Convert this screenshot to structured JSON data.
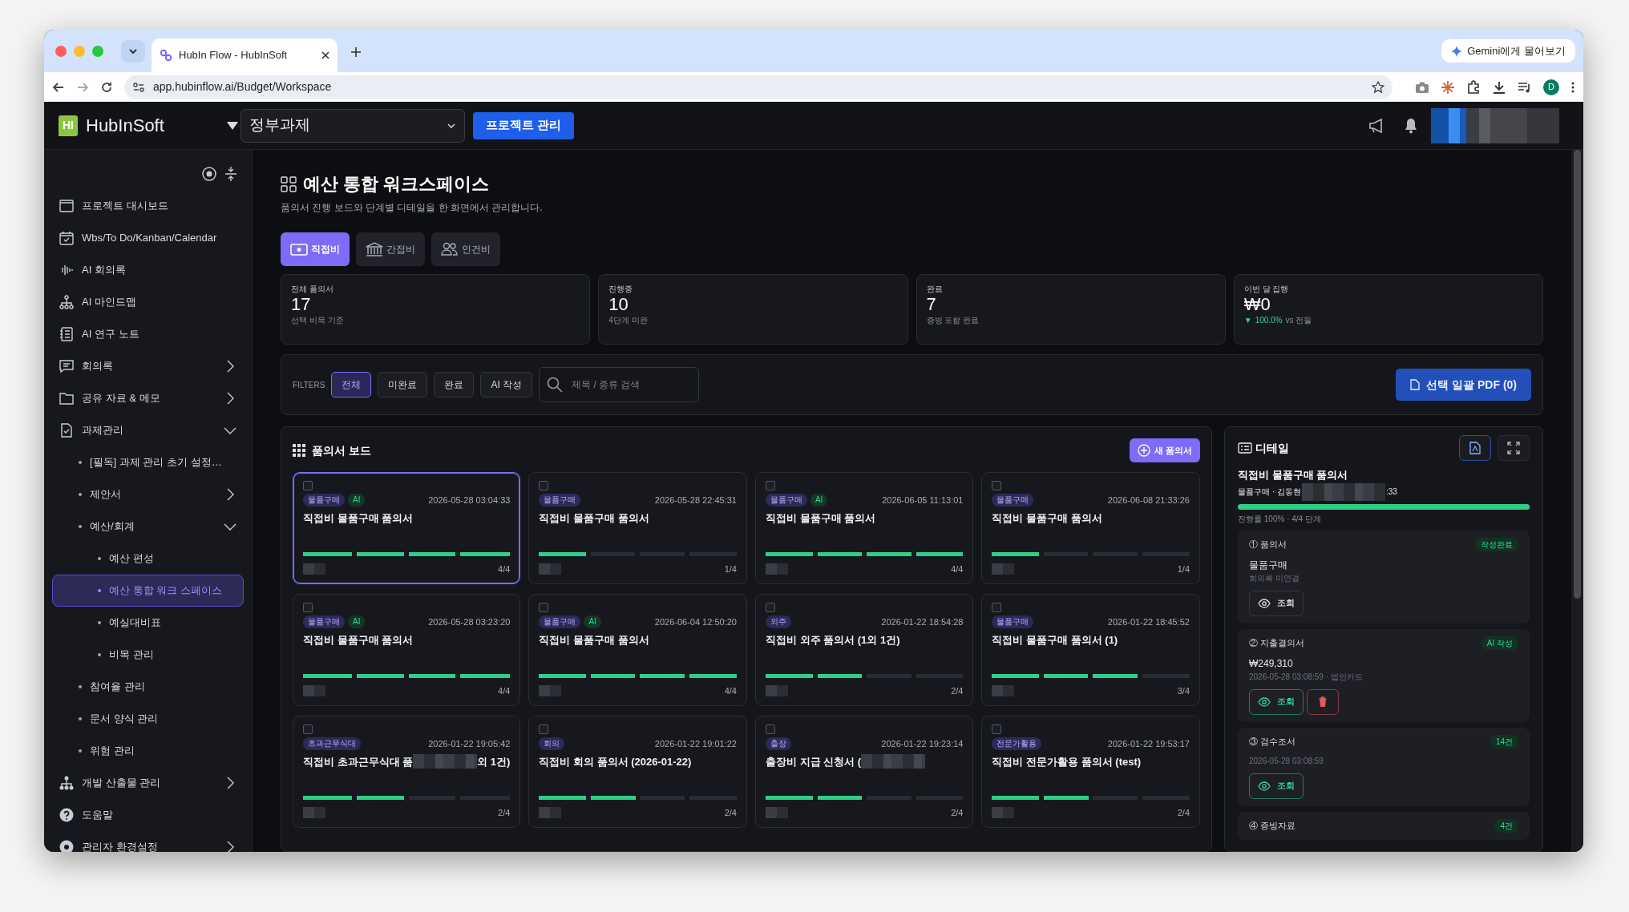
{
  "browser": {
    "tab_title": "HubIn Flow - HubInSoft",
    "url": "app.hubinflow.ai/Budget/Workspace",
    "gemini_button": "Gemini에게 물어보기",
    "profile_initial": "D"
  },
  "header": {
    "logo_mark": "HI",
    "brand": "HubInSoft",
    "project_select": "정부과제",
    "project_button": "프로젝트 관리"
  },
  "sidebar": {
    "items": [
      {
        "label": "프로젝트 대시보드",
        "selected": false
      },
      {
        "label": "Wbs/To Do/Kanban/Calendar",
        "selected": false
      },
      {
        "label": "AI 회의록",
        "selected": false
      },
      {
        "label": "AI 마인드맵",
        "selected": false
      },
      {
        "label": "AI 연구 노트",
        "selected": false
      },
      {
        "label": "회의록",
        "selected": false,
        "expanded": false
      },
      {
        "label": "공유 자료 & 메모",
        "selected": false,
        "expanded": false
      },
      {
        "label": "과제관리",
        "selected": false,
        "expanded": true,
        "children": [
          {
            "label": "[필독] 과제 관리 초기 설정…",
            "selected": false
          },
          {
            "label": "제안서",
            "selected": false,
            "expanded": false
          },
          {
            "label": "예산/회계",
            "selected": false,
            "expanded": true,
            "children": [
              {
                "label": "예산 편성",
                "selected": false
              },
              {
                "label": "예산 통합 워크 스페이스",
                "selected": true
              },
              {
                "label": "예실대비표",
                "selected": false
              },
              {
                "label": "비목 관리",
                "selected": false
              }
            ]
          },
          {
            "label": "참여율 관리",
            "selected": false
          },
          {
            "label": "문서 양식 관리",
            "selected": false
          },
          {
            "label": "위험 관리",
            "selected": false
          }
        ]
      },
      {
        "label": "개발 산출물 관리",
        "selected": false,
        "expanded": false
      },
      {
        "label": "도움말",
        "selected": false
      },
      {
        "label": "관리자 환경설정",
        "selected": false,
        "expanded": false
      }
    ]
  },
  "page": {
    "title": "예산 통합 워크스페이스",
    "subtitle": "품의서 진행 보드와 단계별 디테일을 한 화면에서 관리합니다."
  },
  "tabs": [
    {
      "label": "직접비",
      "selected": true
    },
    {
      "label": "간접비",
      "selected": false
    },
    {
      "label": "인건비",
      "selected": false
    }
  ],
  "stats": [
    {
      "label": "전체 품의서",
      "value": "17",
      "note": "선택 비목 기준"
    },
    {
      "label": "진행중",
      "value": "10",
      "note": "4단계 미완"
    },
    {
      "label": "완료",
      "value": "7",
      "note": "증빙 포함 완료"
    },
    {
      "label": "이번 달 집행",
      "value": "₩0",
      "trend": {
        "arrow": "▼",
        "value": "100.0%",
        "text": "vs 전월"
      }
    }
  ],
  "filters": {
    "label": "FILTERS",
    "chips": [
      {
        "label": "전체",
        "selected": true
      },
      {
        "label": "미완료",
        "selected": false
      },
      {
        "label": "완료",
        "selected": false
      },
      {
        "label": "AI 작성",
        "selected": false
      }
    ],
    "search_placeholder": "제목 / 종류 검색",
    "pdf_button": "선택 일괄 PDF (0)"
  },
  "board": {
    "title": "품의서 보드",
    "new_button": "새 품의서",
    "cards": [
      {
        "selected": true,
        "checked": false,
        "tags": [
          {
            "label": "물품구매",
            "kind": "category"
          },
          {
            "label": "AI",
            "kind": "ai"
          }
        ],
        "date": "2026-05-28 03:04:33",
        "title": "직접비 물품구매 품의서",
        "level": 1,
        "steps": "4/4"
      },
      {
        "selected": false,
        "checked": false,
        "tags": [
          {
            "label": "물품구매",
            "kind": "category"
          }
        ],
        "date": "2026-05-28 22:45:31",
        "title": "직접비 물품구매 품의서",
        "level": 0.25,
        "steps": "1/4"
      },
      {
        "selected": false,
        "checked": false,
        "tags": [
          {
            "label": "물품구매",
            "kind": "category"
          },
          {
            "label": "AI",
            "kind": "ai"
          }
        ],
        "date": "2026-06-05 11:13:01",
        "title": "직접비 물품구매 품의서",
        "level": 1,
        "steps": "4/4"
      },
      {
        "selected": false,
        "checked": false,
        "tags": [
          {
            "label": "물품구매",
            "kind": "category"
          }
        ],
        "date": "2026-06-08 21:33:26",
        "title": "직접비 물품구매 품의서",
        "level": 0.25,
        "steps": "1/4"
      },
      {
        "selected": false,
        "checked": false,
        "tags": [
          {
            "label": "물품구매",
            "kind": "category"
          },
          {
            "label": "AI",
            "kind": "ai"
          }
        ],
        "date": "2026-05-28 03:23:20",
        "title": "직접비 물품구매 품의서",
        "level": 1,
        "steps": "4/4"
      },
      {
        "selected": false,
        "checked": false,
        "tags": [
          {
            "label": "물품구매",
            "kind": "category"
          },
          {
            "label": "AI",
            "kind": "ai"
          }
        ],
        "date": "2026-06-04 12:50:20",
        "title": "직접비 물품구매 품의서",
        "level": 1,
        "steps": "4/4"
      },
      {
        "selected": false,
        "checked": false,
        "tags": [
          {
            "label": "외주",
            "kind": "category"
          }
        ],
        "date": "2026-01-22 18:54:28",
        "title": "직접비 외주 품의서 (1외 1건)",
        "level": 0.5,
        "steps": "2/4"
      },
      {
        "selected": false,
        "checked": false,
        "tags": [
          {
            "label": "물품구매",
            "kind": "category"
          }
        ],
        "date": "2026-01-22 18:45:52",
        "title": "직접비 물품구매 품의서 (1)",
        "level": 0.75,
        "steps": "3/4"
      },
      {
        "selected": false,
        "checked": false,
        "tags": [
          {
            "label": "초과근무식대",
            "kind": "category"
          }
        ],
        "date": "2026-01-22 19:05:42",
        "title": "직접비 초과근무식대 품",
        "title_end": "외 1건)",
        "level": 0.5,
        "steps": "2/4"
      },
      {
        "selected": false,
        "checked": false,
        "tags": [
          {
            "label": "회의",
            "kind": "category"
          }
        ],
        "date": "2026-01-22 19:01:22",
        "title": "직접비 회의 품의서 (2026-01-22)",
        "level": 0.5,
        "steps": "2/4"
      },
      {
        "selected": false,
        "checked": false,
        "tags": [
          {
            "label": "출장",
            "kind": "category"
          }
        ],
        "date": "2026-01-22 19:23:14",
        "title": "출장비 지급 신청서 (",
        "level": 0.5,
        "steps": "2/4"
      },
      {
        "selected": false,
        "checked": false,
        "tags": [
          {
            "label": "전문가활용",
            "kind": "category"
          }
        ],
        "date": "2026-01-22 19:53:17",
        "title": "직접비 전문가활용 품의서 (test)",
        "level": 0.5,
        "steps": "2/4"
      }
    ]
  },
  "detail": {
    "title": "디테일",
    "doc_title": "직접비 물품구매 품의서",
    "meta": "물품구매 · 김동현",
    "meta_end": ":33",
    "level": 1,
    "progress_text": "진행률 100% · 4/4 단계",
    "steps": [
      {
        "number": "①",
        "name": "품의서",
        "badge": "작성완료",
        "main": "물품구매",
        "sub": "회의록 미연결",
        "buttons": [
          {
            "kind": "view-muted",
            "label": "조회"
          }
        ]
      },
      {
        "number": "②",
        "name": "지출결의서",
        "badge": "AI 작성",
        "main": "₩249,310",
        "sub": "2026-05-28 03:08:59 · 법인카드",
        "buttons": [
          {
            "kind": "view",
            "label": "조회"
          },
          {
            "kind": "delete"
          }
        ]
      },
      {
        "number": "③",
        "name": "검수조서",
        "badge": "14건",
        "sub": "2026-05-28 03:08:59",
        "buttons": [
          {
            "kind": "view",
            "label": "조회"
          }
        ]
      },
      {
        "number": "④",
        "name": "증빙자료",
        "badge": "4건"
      }
    ]
  }
}
